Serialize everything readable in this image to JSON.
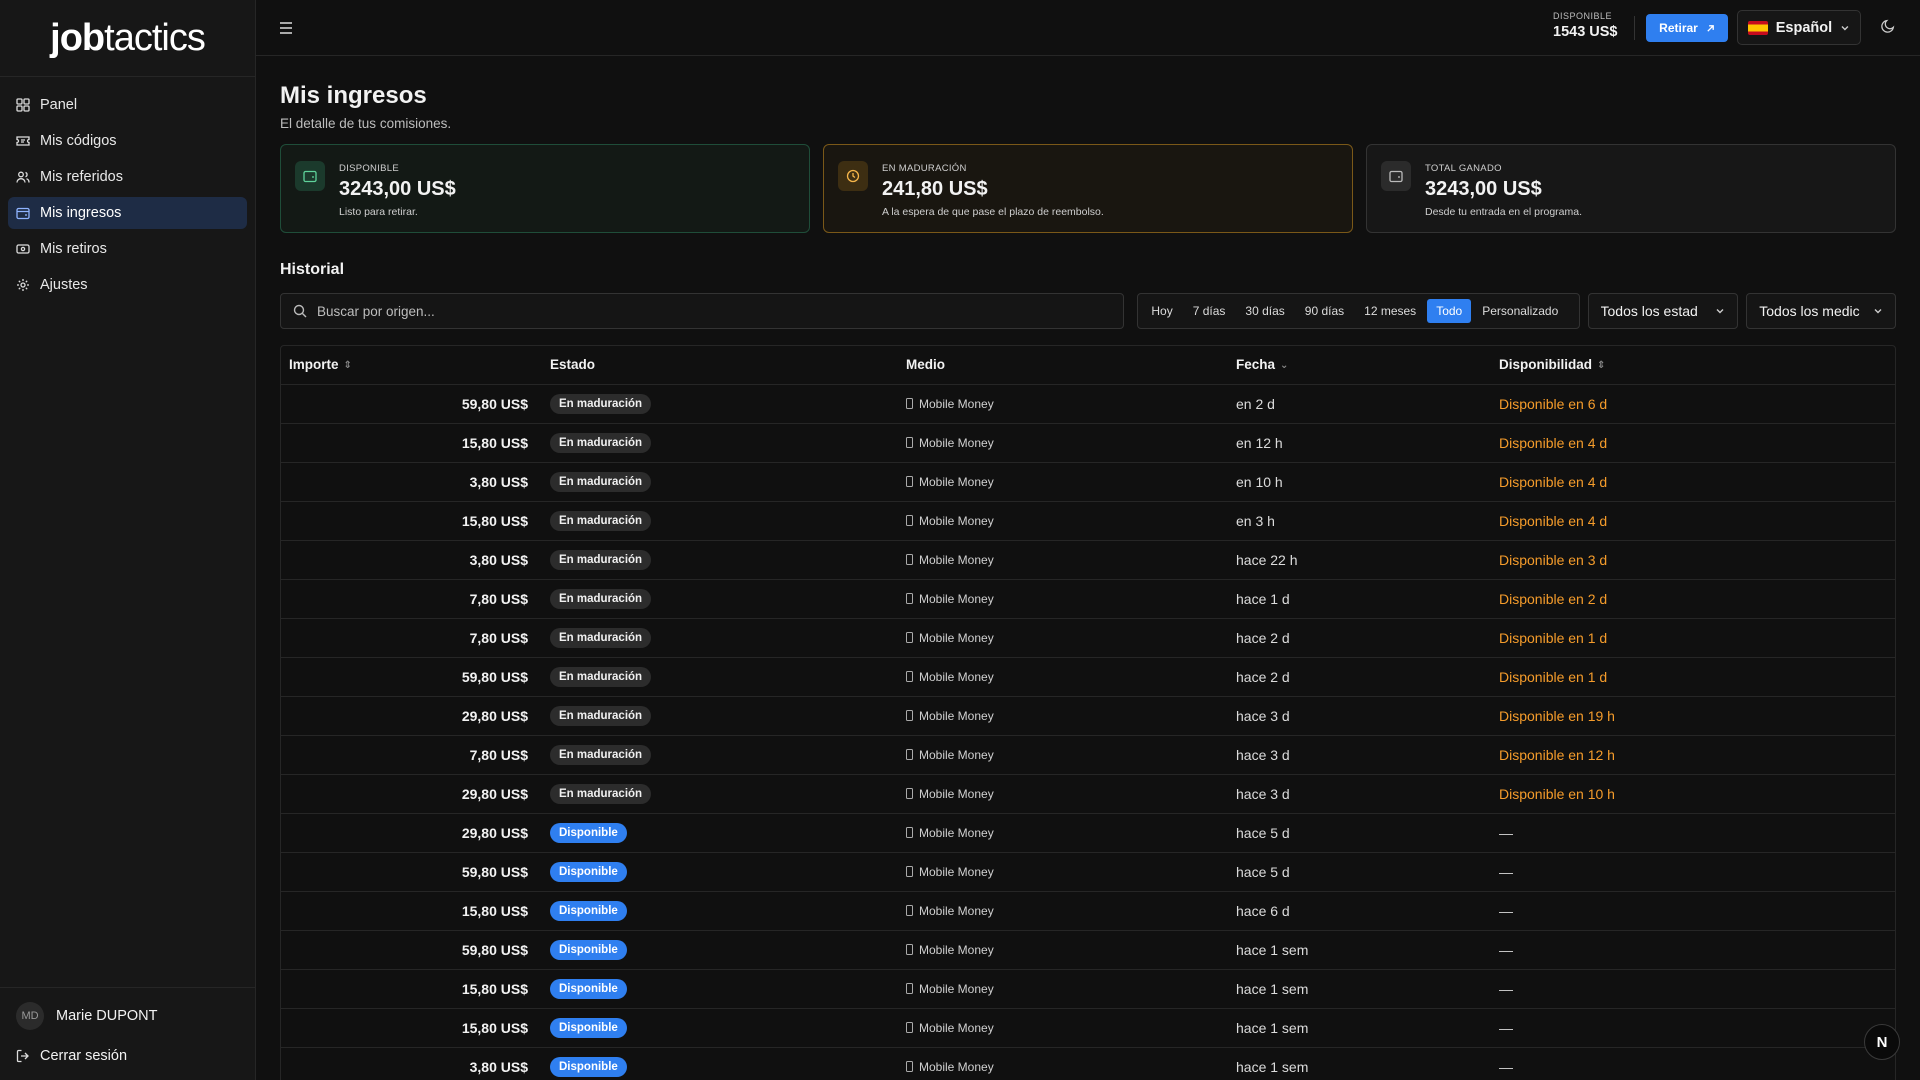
{
  "app": {
    "logo_bold": "job",
    "logo_thin": "tactics"
  },
  "sidebar": {
    "items": [
      {
        "label": "Panel",
        "icon": "grid-icon"
      },
      {
        "label": "Mis códigos",
        "icon": "ticket-icon"
      },
      {
        "label": "Mis referidos",
        "icon": "users-icon"
      },
      {
        "label": "Mis ingresos",
        "icon": "wallet-icon",
        "active": true
      },
      {
        "label": "Mis retiros",
        "icon": "banknote-icon"
      },
      {
        "label": "Ajustes",
        "icon": "gear-icon"
      }
    ],
    "user": {
      "initials": "MD",
      "name": "Marie DUPONT"
    },
    "logout_label": "Cerrar sesión"
  },
  "topbar": {
    "balance_label": "DISPONIBLE",
    "balance_value": "1543 US$",
    "withdraw_label": "Retirar",
    "language_label": "Español"
  },
  "page": {
    "title": "Mis ingresos",
    "subtitle": "El detalle de tus comisiones."
  },
  "cards": [
    {
      "label": "DISPONIBLE",
      "value": "3243,00 US$",
      "desc": "Listo para retirar."
    },
    {
      "label": "EN MADURACIÓN",
      "value": "241,80 US$",
      "desc": "A la espera de que pase el plazo de reembolso."
    },
    {
      "label": "TOTAL GANADO",
      "value": "3243,00 US$",
      "desc": "Desde tu entrada en el programa."
    }
  ],
  "history": {
    "title": "Historial",
    "search_placeholder": "Buscar por origen...",
    "ranges": [
      "Hoy",
      "7 días",
      "30 días",
      "90 días",
      "12 meses",
      "Todo",
      "Personalizado"
    ],
    "active_range": "Todo",
    "status_filter": "Todos los estad",
    "medium_filter": "Todos los medic",
    "columns": [
      "Importe",
      "Estado",
      "Medio",
      "Fecha",
      "Disponibilidad"
    ],
    "rows": [
      {
        "amount": "59,80 US$",
        "status": "En maduración",
        "medium": "Mobile Money",
        "date": "en 2 d",
        "availability": "Disponible en 6 d"
      },
      {
        "amount": "15,80 US$",
        "status": "En maduración",
        "medium": "Mobile Money",
        "date": "en 12 h",
        "availability": "Disponible en 4 d"
      },
      {
        "amount": "3,80 US$",
        "status": "En maduración",
        "medium": "Mobile Money",
        "date": "en 10 h",
        "availability": "Disponible en 4 d"
      },
      {
        "amount": "15,80 US$",
        "status": "En maduración",
        "medium": "Mobile Money",
        "date": "en 3 h",
        "availability": "Disponible en 4 d"
      },
      {
        "amount": "3,80 US$",
        "status": "En maduración",
        "medium": "Mobile Money",
        "date": "hace 22 h",
        "availability": "Disponible en 3 d"
      },
      {
        "amount": "7,80 US$",
        "status": "En maduración",
        "medium": "Mobile Money",
        "date": "hace 1 d",
        "availability": "Disponible en 2 d"
      },
      {
        "amount": "7,80 US$",
        "status": "En maduración",
        "medium": "Mobile Money",
        "date": "hace 2 d",
        "availability": "Disponible en 1 d"
      },
      {
        "amount": "59,80 US$",
        "status": "En maduración",
        "medium": "Mobile Money",
        "date": "hace 2 d",
        "availability": "Disponible en 1 d"
      },
      {
        "amount": "29,80 US$",
        "status": "En maduración",
        "medium": "Mobile Money",
        "date": "hace 3 d",
        "availability": "Disponible en 19 h"
      },
      {
        "amount": "7,80 US$",
        "status": "En maduración",
        "medium": "Mobile Money",
        "date": "hace 3 d",
        "availability": "Disponible en 12 h"
      },
      {
        "amount": "29,80 US$",
        "status": "En maduración",
        "medium": "Mobile Money",
        "date": "hace 3 d",
        "availability": "Disponible en 10 h"
      },
      {
        "amount": "29,80 US$",
        "status": "Disponible",
        "medium": "Mobile Money",
        "date": "hace 5 d",
        "availability": "—"
      },
      {
        "amount": "59,80 US$",
        "status": "Disponible",
        "medium": "Mobile Money",
        "date": "hace 5 d",
        "availability": "—"
      },
      {
        "amount": "15,80 US$",
        "status": "Disponible",
        "medium": "Mobile Money",
        "date": "hace 6 d",
        "availability": "—"
      },
      {
        "amount": "59,80 US$",
        "status": "Disponible",
        "medium": "Mobile Money",
        "date": "hace 1 sem",
        "availability": "—"
      },
      {
        "amount": "15,80 US$",
        "status": "Disponible",
        "medium": "Mobile Money",
        "date": "hace 1 sem",
        "availability": "—"
      },
      {
        "amount": "15,80 US$",
        "status": "Disponible",
        "medium": "Mobile Money",
        "date": "hace 1 sem",
        "availability": "—"
      },
      {
        "amount": "3,80 US$",
        "status": "Disponible",
        "medium": "Mobile Money",
        "date": "hace 1 sem",
        "availability": "—"
      }
    ]
  },
  "floating_badge": "N",
  "colors": {
    "accent": "#2f7ff0",
    "pending": "#f59c2b",
    "background": "#101010"
  }
}
